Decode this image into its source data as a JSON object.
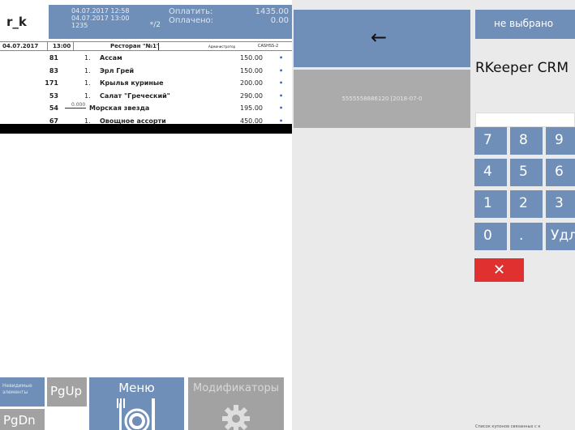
{
  "header": {
    "logo": "r_k",
    "datetime_1": "04.07.2017 12:58",
    "datetime_2": "04.07.2017 13:00",
    "check_no": "1235",
    "guests": "*/2",
    "to_pay_label": "Оплатить:",
    "to_pay_value": "1435.00",
    "paid_label": "Оплачено:",
    "paid_value": "0.00"
  },
  "subheader": {
    "date": "04.07.2017",
    "time": "13:00",
    "restaurant": "Ресторан \"№1\"",
    "waiter": "Администратор",
    "station": "CASHSS-2"
  },
  "orders": [
    {
      "code": "81",
      "qty": "1.",
      "name": "Ассам",
      "price": "150.00",
      "deleted": false
    },
    {
      "code": "83",
      "qty": "1.",
      "name": "Эрл Грей",
      "price": "150.00",
      "deleted": false
    },
    {
      "code": "171",
      "qty": "1.",
      "name": "Крылья куриные",
      "price": "200.00",
      "deleted": false
    },
    {
      "code": "53",
      "qty": "1.",
      "name": "Салат \"Греческий\"",
      "price": "290.00",
      "deleted": false
    },
    {
      "code": "54",
      "qty": "0.000",
      "name": "Морская звезда",
      "price": "195.00",
      "deleted": true
    },
    {
      "code": "67",
      "qty": "1.",
      "name": "Овощное ассорти",
      "price": "450.00",
      "deleted": false
    }
  ],
  "bottom_buttons": {
    "modifiers_small": "Невидимые элементы",
    "pgup": "PgUp",
    "pgdn": "PgDn",
    "menu": "Меню",
    "modificators": "Модификаторы"
  },
  "middle": {
    "card_text": "5555558886120  [2018-07-0"
  },
  "right": {
    "not_selected": "не выбрано",
    "crm_title": "RKeeper CRM",
    "keys": [
      "7",
      "8",
      "9",
      "4",
      "5",
      "6",
      "1",
      "2",
      "3",
      "0",
      ".",
      "Удл"
    ],
    "clear_symbol": "✕",
    "list_caption": "Список купонов связанных с к"
  },
  "colors": {
    "button_blue": "#6f8fb8",
    "button_grey": "#a2a2a2",
    "clear_red": "#e03030",
    "panel_bg": "#eaeaea"
  },
  "icons": [
    "back-arrow-icon",
    "plate-icon",
    "gear-icon",
    "close-icon"
  ]
}
